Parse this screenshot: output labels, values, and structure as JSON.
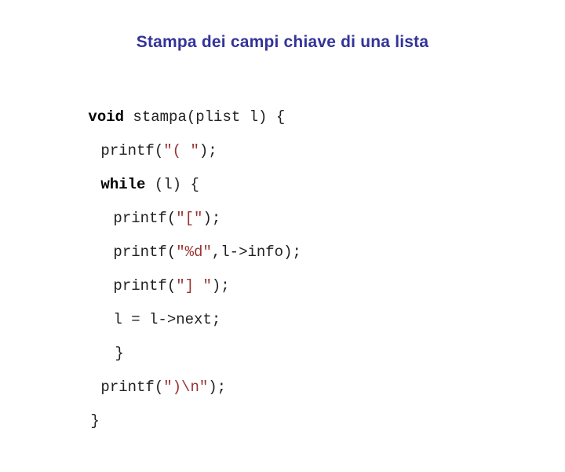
{
  "slide": {
    "title": "Stampa dei campi chiave di una lista",
    "title_color": "#333399",
    "background_color": "#ffffff",
    "code_colors": {
      "keyword": "#000000",
      "plain": "#222222",
      "string": "#993333"
    },
    "code_lines": [
      {
        "indent": 0,
        "keyword": "void",
        "after_keyword": " stampa(plist l) {",
        "string": "",
        "tail": ""
      },
      {
        "indent": 1,
        "keyword": "",
        "after_keyword": "printf(",
        "string": "\"( \"",
        "tail": ");"
      },
      {
        "indent": 1,
        "keyword": "while",
        "after_keyword": " (l) {",
        "string": "",
        "tail": ""
      },
      {
        "indent": 2,
        "keyword": "",
        "after_keyword": "printf(",
        "string": "\"[\"",
        "tail": ");"
      },
      {
        "indent": 2,
        "keyword": "",
        "after_keyword": "printf(",
        "string": "\"%d\"",
        "tail": ",l->info);"
      },
      {
        "indent": 2,
        "keyword": "",
        "after_keyword": "printf(",
        "string": "\"] \"",
        "tail": ");"
      },
      {
        "indent": 2,
        "keyword": "",
        "after_keyword": "l = l->next;",
        "string": "",
        "tail": ""
      },
      {
        "indent": 3,
        "keyword": "",
        "after_keyword": "}",
        "string": "",
        "tail": ""
      },
      {
        "indent": 1,
        "keyword": "",
        "after_keyword": "printf(",
        "string": "\")\\n\"",
        "tail": ");"
      },
      {
        "indent": 4,
        "keyword": "",
        "after_keyword": "}",
        "string": "",
        "tail": ""
      }
    ]
  }
}
